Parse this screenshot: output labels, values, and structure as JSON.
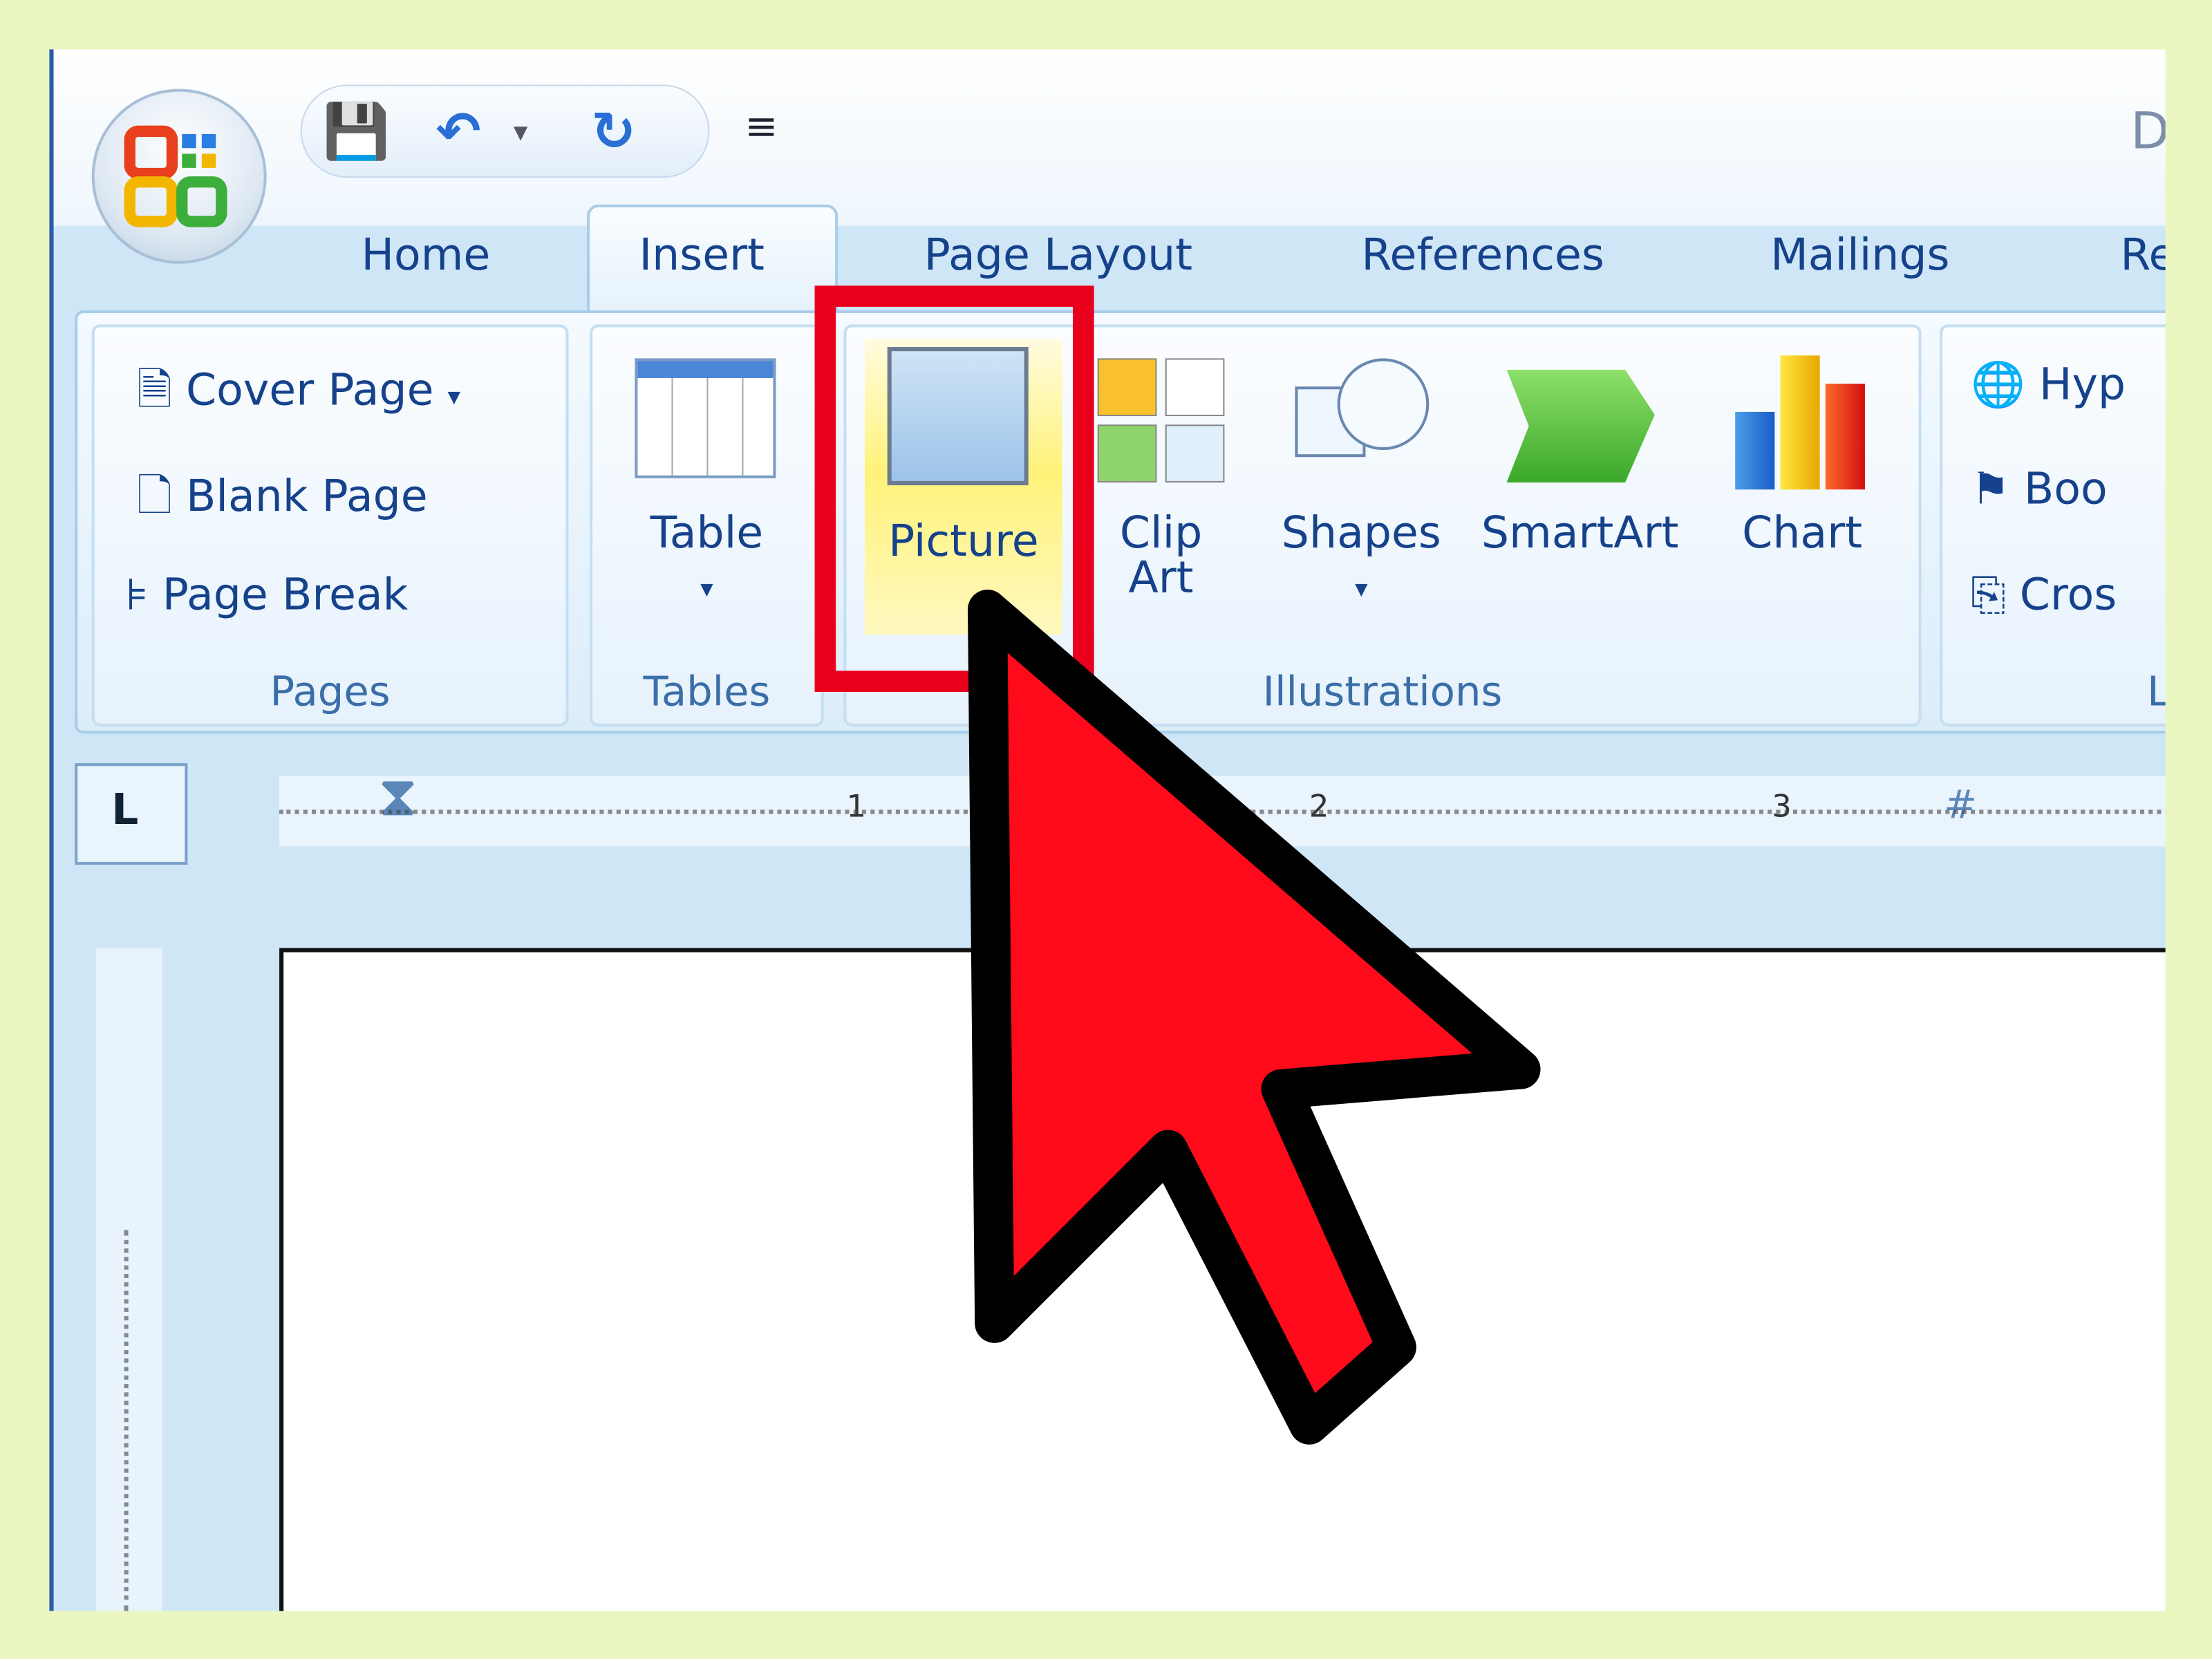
{
  "window": {
    "title_fragment": "D"
  },
  "qat": {
    "icons": [
      "save-icon",
      "undo-icon",
      "redo-icon",
      "customize-icon"
    ]
  },
  "tabs": [
    {
      "label": "Home"
    },
    {
      "label": "Insert",
      "selected": true
    },
    {
      "label": "Page Layout"
    },
    {
      "label": "References"
    },
    {
      "label": "Mailings"
    },
    {
      "label": "Re"
    }
  ],
  "ribbon": {
    "pages": {
      "label": "Pages",
      "items": [
        "Cover Page",
        "Blank Page",
        "Page Break"
      ]
    },
    "tables": {
      "label": "Tables",
      "table": "Table"
    },
    "illustrations": {
      "label": "Illustrations",
      "picture": "Picture",
      "clip_art_1": "Clip",
      "clip_art_2": "Art",
      "shapes": "Shapes",
      "smartart": "SmartArt",
      "chart": "Chart"
    },
    "links": {
      "label": "L",
      "items": [
        "Hyp",
        "Boo",
        "Cros"
      ]
    }
  },
  "ruler": {
    "numbers": [
      "1",
      "2",
      "3"
    ]
  },
  "colors": {
    "highlight": "#e8001c",
    "cursor": "#ff0a1a",
    "border": "#eaf7c0",
    "accent_text": "#15428b"
  }
}
